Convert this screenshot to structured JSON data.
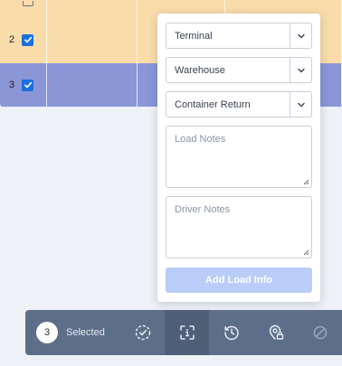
{
  "grid": {
    "rows": [
      {
        "number": "",
        "checked": false
      },
      {
        "number": "2",
        "checked": true
      },
      {
        "number": "3",
        "checked": true
      }
    ]
  },
  "panel": {
    "terminal": {
      "value": "Terminal"
    },
    "warehouse": {
      "value": "Warehouse"
    },
    "container_return": {
      "value": "Container Return"
    },
    "load_notes": {
      "placeholder": "Load Notes"
    },
    "driver_notes": {
      "placeholder": "Driver Notes"
    },
    "add_button": "Add Load Info"
  },
  "toolbar": {
    "count": "3",
    "selected_label": "Selected",
    "buttons": [
      "check-circle-icon",
      "scan-info-icon",
      "clock-icon",
      "location-lock-icon",
      "disabled-action-icon"
    ]
  },
  "colors": {
    "row_orange": "#fadcaa",
    "row_selected": "#8a96d6",
    "toolbar": "#5d6f88",
    "button_disabled": "#b9cdf8",
    "checkbox": "#1a6fdf"
  }
}
